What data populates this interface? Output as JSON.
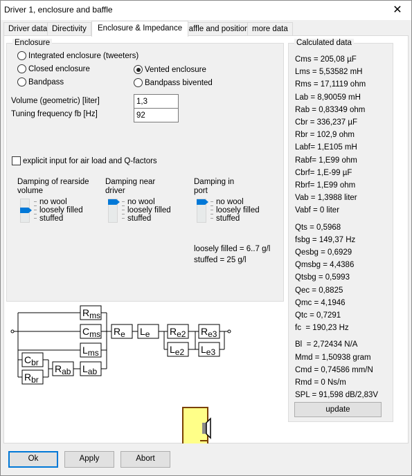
{
  "window": {
    "title": "Driver 1, enclosure and baffle",
    "close_icon": "close-icon"
  },
  "tabs": [
    {
      "label": "Driver data",
      "active": false
    },
    {
      "label": "Directivity",
      "active": false
    },
    {
      "label": "Enclosure & Impedance",
      "active": true
    },
    {
      "label": "Baffle and position",
      "active": false
    },
    {
      "label": "more data",
      "active": false
    }
  ],
  "enclosure": {
    "legend": "Enclosure",
    "options": [
      {
        "label": "Integrated enclosure (tweeters)",
        "checked": false
      },
      {
        "label": "Closed enclosure",
        "checked": false
      },
      {
        "label": "Vented enclosure",
        "checked": true
      },
      {
        "label": "Bandpass",
        "checked": false
      },
      {
        "label": "Bandpass bivented",
        "checked": false
      }
    ],
    "volume_label": "Volume (geometric) [liter]",
    "volume_value": "1,3",
    "tuning_label": "Tuning frequency fb [Hz]",
    "tuning_value": "92",
    "explicit_input_label": "explicit input for air load and Q-factors",
    "explicit_input_checked": false,
    "damping": [
      {
        "title": "Damping of rearside volume",
        "levels": [
          "no wool",
          "loosely filled",
          "stuffed"
        ],
        "selected": "loosely filled"
      },
      {
        "title": "Damping near driver",
        "levels": [
          "no wool",
          "loosely filled",
          "stuffed"
        ],
        "selected": "no wool"
      },
      {
        "title": "Damping in port",
        "levels": [
          "no wool",
          "loosely filled",
          "stuffed"
        ],
        "selected": "no wool"
      }
    ],
    "notes": [
      "loosely filled = 6..7 g/l",
      "stuffed = 25 g/l"
    ]
  },
  "calculated": {
    "legend": "Calculated data",
    "group1": [
      "Cms = 205,08 µF",
      "Lms = 5,53582 mH",
      "Rms = 17,1119 ohm",
      "Lab = 8,90059 mH",
      "Rab = 0,83349 ohm",
      "Cbr = 336,237 µF",
      "Rbr = 102,9 ohm",
      "Labf= 1,E105 mH",
      "Rabf= 1,E99 ohm",
      "Cbrf= 1,E-99 µF",
      "Rbrf= 1,E99 ohm",
      "Vab = 1,3988 liter",
      "Vabf = 0 liter"
    ],
    "group2": [
      "Qts = 0,5968",
      "fsbg = 149,37 Hz",
      "Qesbg = 0,6929",
      "Qmsbg = 4,4386",
      "Qtsbg = 0,5993",
      "Qec = 0,8825",
      "Qmc = 4,1946",
      "Qtc = 0,7291",
      "fc  = 190,23 Hz"
    ],
    "group3": [
      "Bl  = 2,72434 N/A",
      "Mmd = 1,50938 gram",
      "Cmd = 0,74586 mm/N",
      "Rmd = 0 Ns/m",
      "SPL = 91,598 dB/2,83V"
    ],
    "update_label": "update"
  },
  "circuit": {
    "components": [
      {
        "id": "Rms",
        "base": "R",
        "sub": "ms"
      },
      {
        "id": "Cms",
        "base": "C",
        "sub": "ms"
      },
      {
        "id": "Lms",
        "base": "L",
        "sub": "ms"
      },
      {
        "id": "Cbr",
        "base": "C",
        "sub": "br"
      },
      {
        "id": "Rbr",
        "base": "R",
        "sub": "br"
      },
      {
        "id": "Rab",
        "base": "R",
        "sub": "ab"
      },
      {
        "id": "Lab",
        "base": "L",
        "sub": "ab"
      },
      {
        "id": "Re",
        "base": "R",
        "sub": "e"
      },
      {
        "id": "Le",
        "base": "L",
        "sub": "e"
      },
      {
        "id": "Re2",
        "base": "R",
        "sub": "e2"
      },
      {
        "id": "Le2",
        "base": "L",
        "sub": "e2"
      },
      {
        "id": "Re3",
        "base": "R",
        "sub": "e3"
      },
      {
        "id": "Le3",
        "base": "L",
        "sub": "e3"
      }
    ],
    "enclosure_fill": "#ffff88",
    "enclosure_stroke": "#7a4000"
  },
  "footer": {
    "ok_label": "Ok",
    "apply_label": "Apply",
    "abort_label": "Abort"
  },
  "colors": {
    "accent": "#0078d7"
  }
}
